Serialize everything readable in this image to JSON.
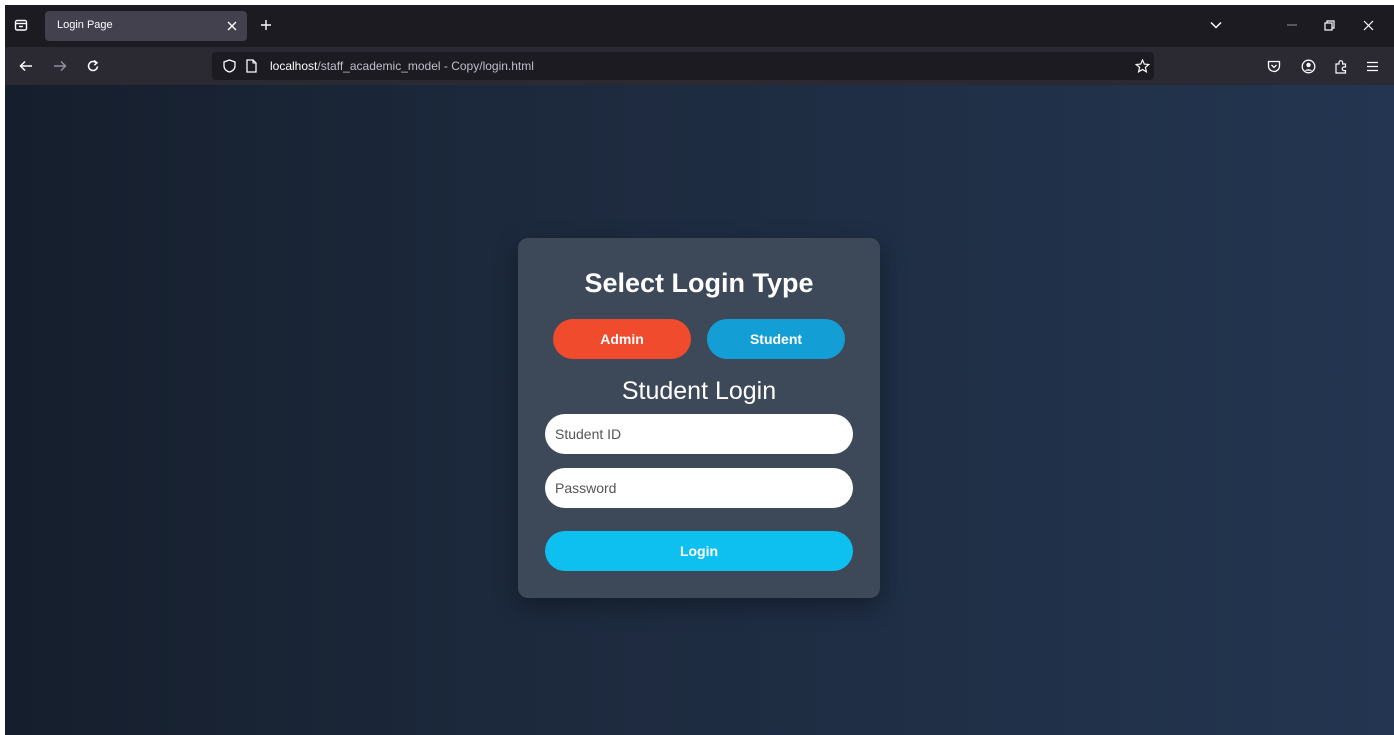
{
  "browser": {
    "tab": {
      "title": "Login Page"
    },
    "url": {
      "host": "localhost",
      "path": "/staff_academic_model - Copy/login.html"
    },
    "icons": {
      "tab_list": "tab-list-icon",
      "tab_close": "close-icon",
      "new_tab": "plus-icon",
      "list_all_tabs": "chevron-down-icon",
      "minimize": "minimize-icon",
      "restore": "restore-icon",
      "close_window": "close-icon",
      "back": "arrow-left-icon",
      "forward": "arrow-right-icon",
      "reload": "reload-icon",
      "tracking_protection": "shield-icon",
      "page_info": "page-icon",
      "bookmark": "star-icon",
      "pocket": "pocket-icon",
      "account": "account-icon",
      "extensions": "extensions-icon",
      "menu": "hamburger-icon"
    }
  },
  "page": {
    "heading": "Select Login Type",
    "login_types": {
      "admin": "Admin",
      "student": "Student"
    },
    "form_title": "Student Login",
    "fields": {
      "student_id_placeholder": "Student ID",
      "password_placeholder": "Password"
    },
    "submit_label": "Login"
  },
  "colors": {
    "admin_button": "#f04b2c",
    "student_button": "#139fd6",
    "login_button": "#0ec0f0",
    "card": "#3d4858",
    "background_left": "#151e2c",
    "background_right": "#233550"
  }
}
